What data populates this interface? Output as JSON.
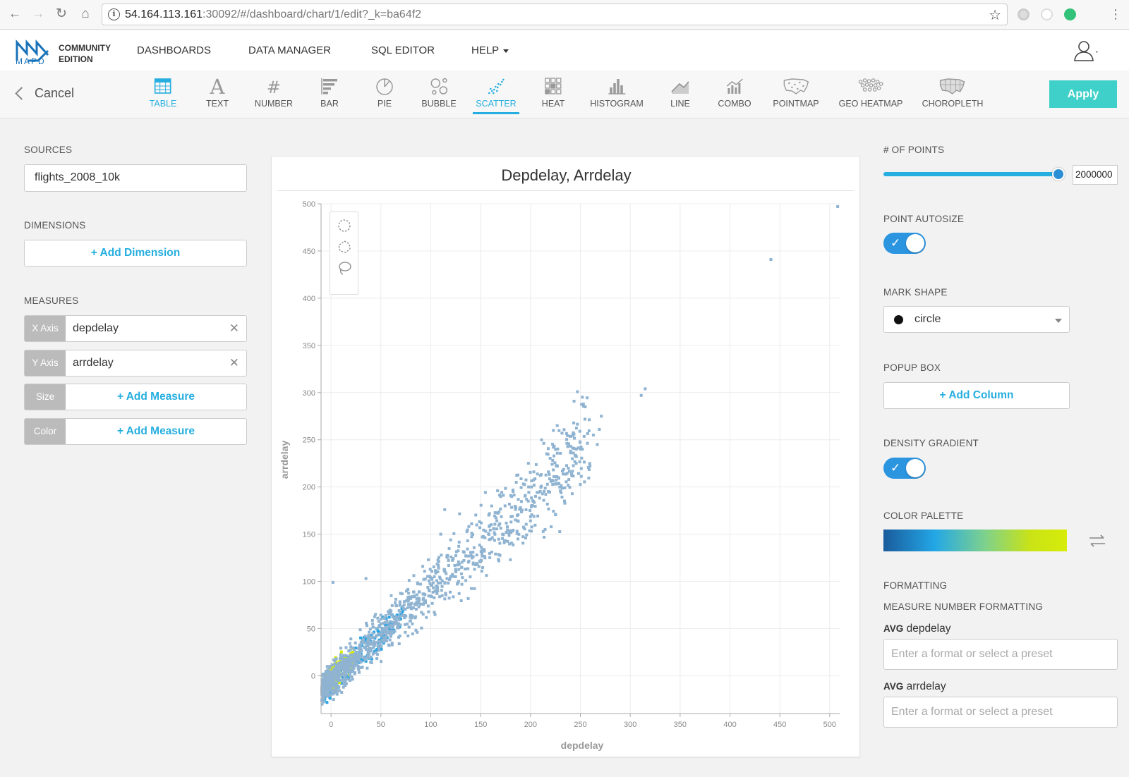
{
  "browser": {
    "url_host": "54.164.113.161",
    "url_rest": ":30092/#/dashboard/chart/1/edit?_k=ba64f2"
  },
  "app": {
    "logo_word": "MAPD",
    "edition_line1": "COMMUNITY",
    "edition_line2": "EDITION",
    "nav": [
      "DASHBOARDS",
      "DATA MANAGER",
      "SQL EDITOR",
      "HELP"
    ]
  },
  "toolbar": {
    "cancel_label": "Cancel",
    "apply_label": "Apply",
    "chart_types": [
      {
        "label": "TABLE",
        "icon": "table-icon"
      },
      {
        "label": "TEXT",
        "icon": "text-icon"
      },
      {
        "label": "NUMBER",
        "icon": "number-icon"
      },
      {
        "label": "BAR",
        "icon": "bar-icon"
      },
      {
        "label": "PIE",
        "icon": "pie-icon"
      },
      {
        "label": "BUBBLE",
        "icon": "bubble-icon"
      },
      {
        "label": "SCATTER",
        "icon": "scatter-icon"
      },
      {
        "label": "HEAT",
        "icon": "heat-icon"
      },
      {
        "label": "HISTOGRAM",
        "icon": "histogram-icon"
      },
      {
        "label": "LINE",
        "icon": "line-icon"
      },
      {
        "label": "COMBO",
        "icon": "combo-icon"
      },
      {
        "label": "POINTMAP",
        "icon": "pointmap-icon"
      },
      {
        "label": "GEO HEATMAP",
        "icon": "geo-heatmap-icon"
      },
      {
        "label": "CHOROPLETH",
        "icon": "choropleth-icon"
      }
    ],
    "active_type": "SCATTER"
  },
  "left": {
    "sources_label": "SOURCES",
    "source_value": "flights_2008_10k",
    "dimensions_label": "DIMENSIONS",
    "add_dimension_label": "+ Add Dimension",
    "measures_label": "MEASURES",
    "x_axis": {
      "tag": "X Axis",
      "value": "depdelay"
    },
    "y_axis": {
      "tag": "Y Axis",
      "value": "arrdelay"
    },
    "size": {
      "tag": "Size",
      "add_label": "+ Add Measure"
    },
    "color": {
      "tag": "Color",
      "add_label": "+ Add Measure"
    }
  },
  "right": {
    "points_label": "# OF POINTS",
    "points_value": "2000000",
    "points_slider_fraction": 1.0,
    "autosize_label": "POINT AUTOSIZE",
    "autosize_on": true,
    "mark_shape_label": "MARK SHAPE",
    "mark_shape_value": "circle",
    "popup_label": "POPUP BOX",
    "add_column_label": "+ Add Column",
    "density_label": "DENSITY GRADIENT",
    "density_on": true,
    "palette_label": "COLOR PALETTE",
    "palette_colors": [
      "#1a5b9c",
      "#23a7e6",
      "#7dd18e",
      "#c9e316",
      "#d7ec0a"
    ],
    "formatting_label": "FORMATTING",
    "measure_format_label": "MEASURE NUMBER FORMATTING",
    "fmt_x_agg": "AVG",
    "fmt_x_name": "depdelay",
    "fmt_y_agg": "AVG",
    "fmt_y_name": "arrdelay",
    "fmt_placeholder": "Enter a format or select a preset"
  },
  "chart_data": {
    "type": "scatter",
    "title": "Depdelay,  Arrdelay",
    "xlabel": "depdelay",
    "ylabel": "arrdelay",
    "xlim": [
      -10,
      510
    ],
    "ylim": [
      -40,
      500
    ],
    "xticks": [
      0,
      50,
      100,
      150,
      200,
      250,
      300,
      350,
      400,
      450,
      500
    ],
    "yticks": [
      0,
      50,
      100,
      150,
      200,
      250,
      300,
      350,
      400,
      450,
      500
    ],
    "grid": true,
    "point_color": "#8fb3d1",
    "density_colors": [
      "#2aa3e2",
      "#d7ec0a"
    ],
    "outliers": [
      [
        441,
        441
      ],
      [
        508,
        497
      ],
      [
        315,
        304
      ],
      [
        311,
        297
      ],
      [
        271,
        275
      ],
      [
        269,
        261
      ],
      [
        263,
        255
      ],
      [
        267,
        245
      ],
      [
        252,
        240
      ],
      [
        243,
        236
      ],
      [
        242,
        230
      ],
      [
        218,
        216
      ],
      [
        201,
        200
      ],
      [
        114,
        176
      ],
      [
        141,
        161
      ],
      [
        2,
        99
      ],
      [
        35,
        103
      ],
      [
        110,
        150
      ]
    ],
    "trend": {
      "slope": 0.985,
      "intercept": -6
    }
  }
}
